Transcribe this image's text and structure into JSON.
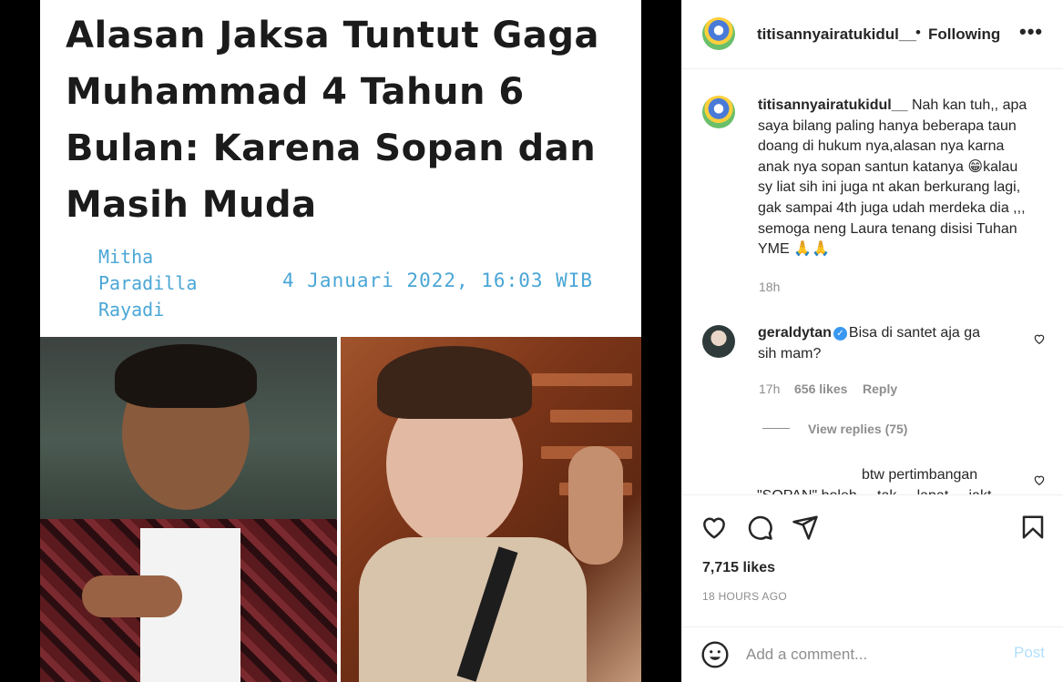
{
  "media": {
    "headline_lines": [
      "Alasan Jaksa Tuntut Gaga",
      "Muhammad 4 Tahun 6",
      "Bulan: Karena Sopan dan",
      "Masih Muda"
    ],
    "author_lines": [
      "Mitha",
      "Paradilla",
      "Rayadi"
    ],
    "date": "4 Januari 2022, 16:03 WIB"
  },
  "header": {
    "username": "titisannyairatukidul__",
    "dot": "•",
    "follow_state": "Following",
    "more_icon": "more-horizontal-icon"
  },
  "caption": {
    "username": "titisannyairatukidul__",
    "lines": [
      "Nah kan tuh,, apa",
      "saya bilang paling hanya beberapa taun",
      "doang di hukum nya,alasan nya karna",
      "anak nya sopan santun katanya 😁kalau",
      "sy liat sih ini juga nt akan berkurang lagi,",
      "gak sampai 4th juga udah merdeka dia ,,,",
      "semoga neng Laura tenang disisi Tuhan",
      "YME 🙏🙏"
    ],
    "time": "18h"
  },
  "comment1": {
    "username": "geraldytan",
    "text_line1": "Bisa di santet aja ga",
    "text_line2": "sih mam?",
    "time": "17h",
    "likes": "656 likes",
    "reply": "Reply",
    "view_replies": "View replies (75)"
  },
  "comment2": {
    "text_line1": "btw pertimbangan",
    "text_line2": "\"SOPAN\" boleh ... tak ... lapat ... jakt"
  },
  "actions": {
    "likes": "7,715 likes",
    "ago": "18 HOURS AGO"
  },
  "composer": {
    "placeholder": "Add a comment...",
    "post_label": "Post"
  },
  "colors": {
    "link_blue": "#4aa6d6",
    "post_disabled": "#b2dffc",
    "verified": "#3897f0",
    "muted": "#8e8e8e"
  }
}
